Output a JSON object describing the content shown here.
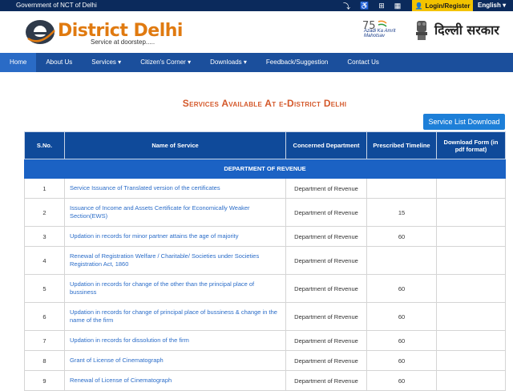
{
  "topbar": {
    "gov_label": "Government of NCT of Delhi",
    "login_label": "Login/Register",
    "language": "English"
  },
  "header": {
    "brand": "District Delhi",
    "tagline": "Service at doorstep.....",
    "azadi_text": "Azadi Ka Amrit Mahotsav",
    "sarkar_text": "दिल्ली सरकार"
  },
  "nav": {
    "items": [
      "Home",
      "About Us",
      "Services",
      "Citizen's Corner",
      "Downloads",
      "Feedback/Suggestion",
      "Contact Us"
    ]
  },
  "main": {
    "heading": "Services Available At e-District Delhi",
    "download_button": "Service List Download"
  },
  "table": {
    "headers": [
      "S.No.",
      "Name of Service",
      "Concerned Department",
      "Prescribed Timeline",
      "Download Form (in pdf format)"
    ],
    "section": "DEPARTMENT OF REVENUE",
    "rows": [
      {
        "sn": "1",
        "service": "Service Issuance of Translated version of the certificates",
        "dept": "Department of Revenue",
        "timeline": ""
      },
      {
        "sn": "2",
        "service": "Issuance of Income and Assets Certificate for Economically Weaker Section(EWS)",
        "dept": "Department of Revenue",
        "timeline": "15"
      },
      {
        "sn": "3",
        "service": "Updation in records for minor partner attains the age of majority",
        "dept": "Department of Revenue",
        "timeline": "60"
      },
      {
        "sn": "4",
        "service": "Renewal of Registration Welfare / Charitable/ Societies under Societies Registration Act, 1860",
        "dept": "Department of Revenue",
        "timeline": ""
      },
      {
        "sn": "5",
        "service": "Updation in records for change of the other than the principal place of bussiness",
        "dept": "Department of Revenue",
        "timeline": "60"
      },
      {
        "sn": "6",
        "service": "Updation in records for change of principal place of bussiness & change in the name of the firm",
        "dept": "Department of Revenue",
        "timeline": "60"
      },
      {
        "sn": "7",
        "service": "Updation in records for dissolution of the firm",
        "dept": "Department of Revenue",
        "timeline": "60"
      },
      {
        "sn": "8",
        "service": "Grant of License of Cinematograph",
        "dept": "Department of Revenue",
        "timeline": "60"
      },
      {
        "sn": "9",
        "service": "Renewal of License of Cinematograph",
        "dept": "Department of Revenue",
        "timeline": "60"
      }
    ]
  },
  "colors": {
    "topbar": "#0b2a5c",
    "nav": "#1b4f9c",
    "brand_orange": "#e07a10",
    "heading": "#d4582a",
    "table_header": "#0f4a9a",
    "link": "#2a6cc8"
  }
}
